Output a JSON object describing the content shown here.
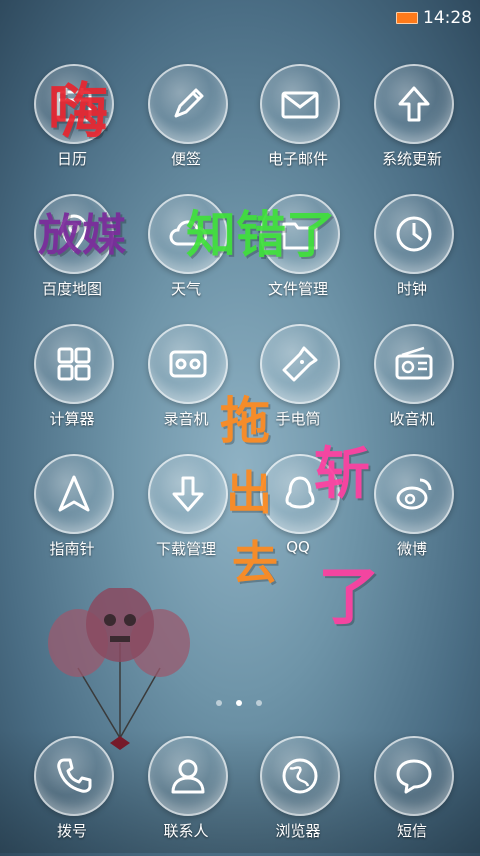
{
  "status_bar": {
    "time": "14:28",
    "battery_color": "#ff7a1a"
  },
  "apps": [
    {
      "label": "日历"
    },
    {
      "label": "便签"
    },
    {
      "label": "电子邮件"
    },
    {
      "label": "系统更新"
    },
    {
      "label": "百度地图"
    },
    {
      "label": "天气"
    },
    {
      "label": "文件管理"
    },
    {
      "label": "时钟"
    },
    {
      "label": "计算器"
    },
    {
      "label": "录音机"
    },
    {
      "label": "手电筒"
    },
    {
      "label": "收音机"
    },
    {
      "label": "指南针"
    },
    {
      "label": "下载管理"
    },
    {
      "label": "QQ"
    },
    {
      "label": "微博"
    }
  ],
  "dock": [
    {
      "label": "拨号"
    },
    {
      "label": "联系人"
    },
    {
      "label": "浏览器"
    },
    {
      "label": "短信"
    }
  ],
  "overlay_text": {
    "t1": "嗨",
    "t2": "放媒",
    "t3": "知错了",
    "t4": "拖",
    "t5": "出",
    "t6": "去",
    "t7": "斩",
    "t8": "了"
  },
  "page_indicator": {
    "current": 2,
    "total": 3
  }
}
